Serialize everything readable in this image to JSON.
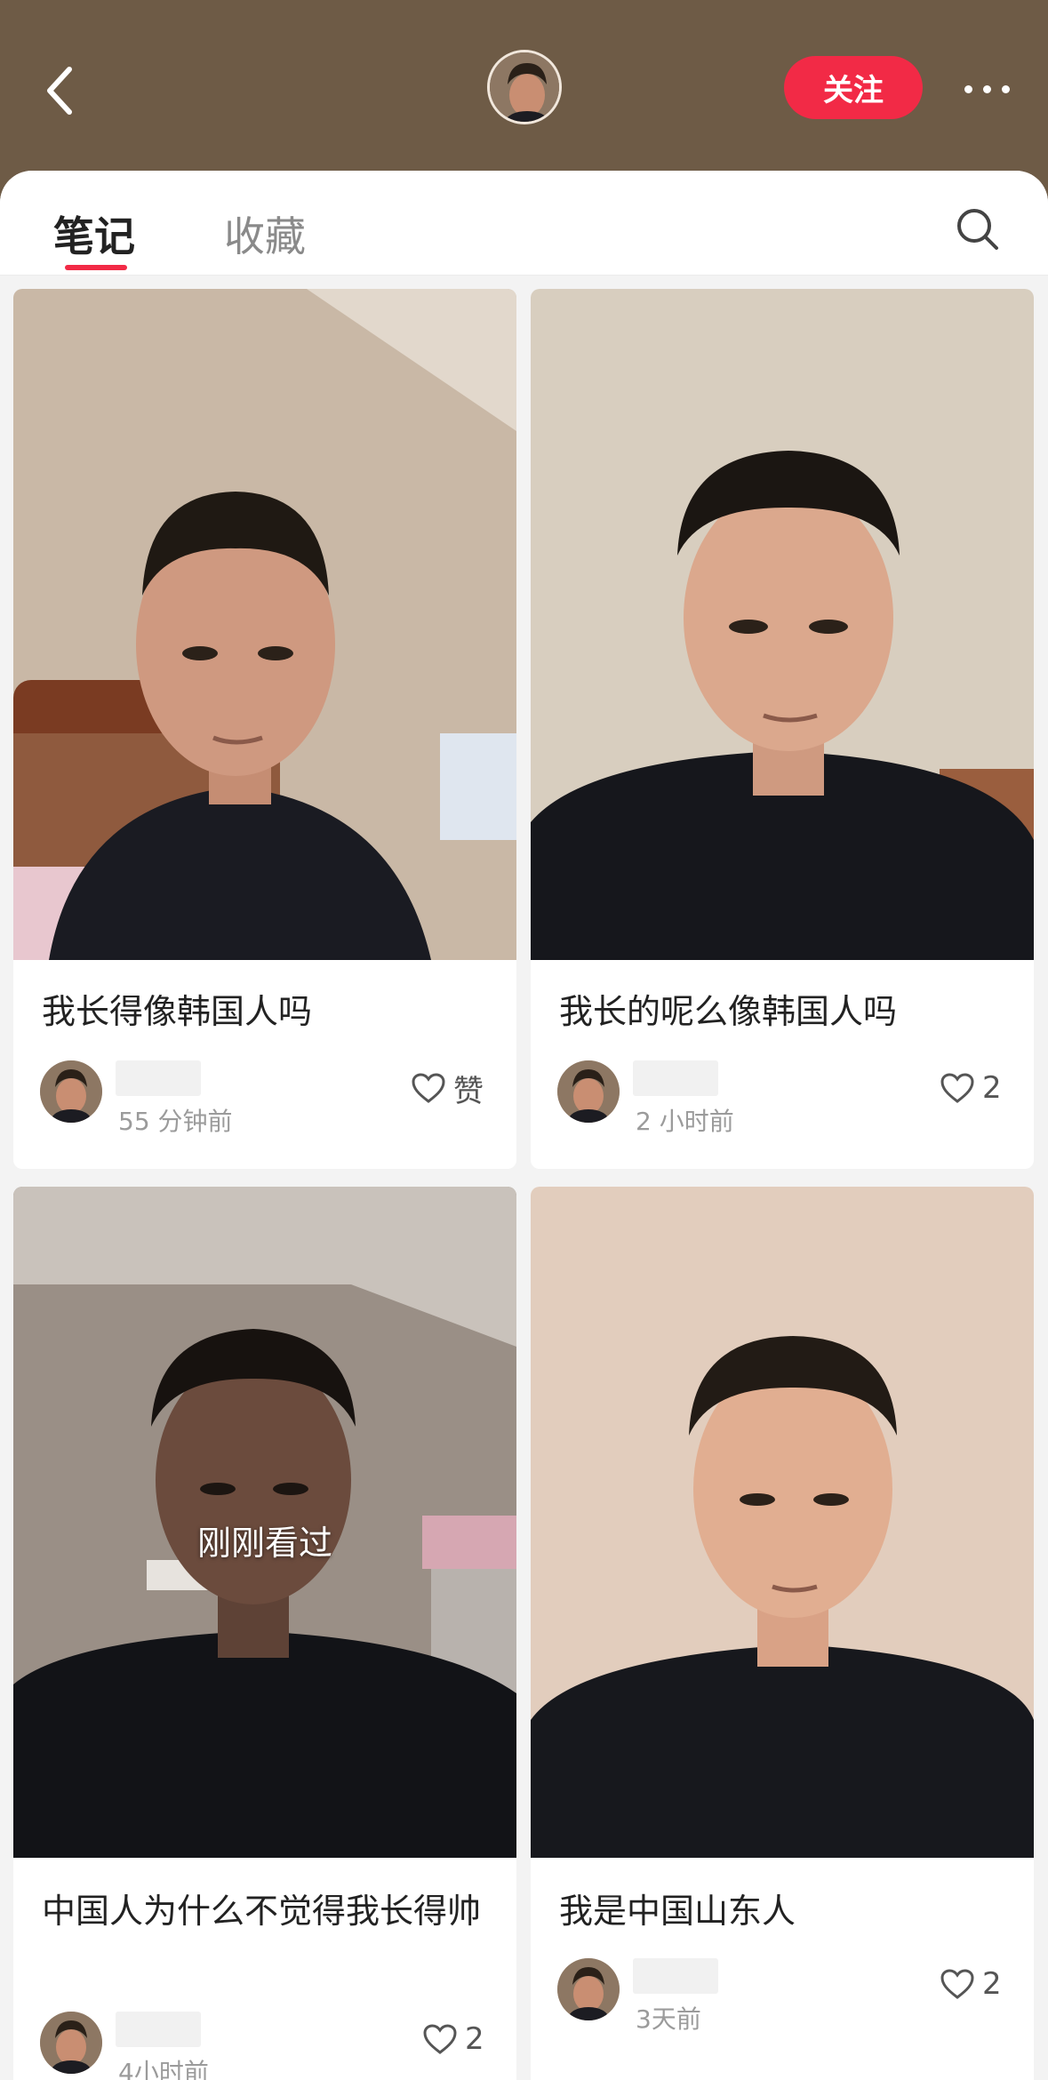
{
  "header": {
    "follow_label": "关注"
  },
  "tabs": {
    "notes": "笔记",
    "collect": "收藏"
  },
  "cards": [
    {
      "title": "我长得像韩国人吗",
      "time": "55 分钟前",
      "likes": "赞",
      "watched": ""
    },
    {
      "title": "我长的呢么像韩国人吗",
      "time": "2 小时前",
      "likes": "2",
      "watched": ""
    },
    {
      "title": "中国人为什么不觉得我长得帅",
      "time": "4小时前",
      "likes": "2",
      "watched": "刚刚看过"
    },
    {
      "title": "我是中国山东人",
      "time": "3天前",
      "likes": "2",
      "watched": ""
    }
  ],
  "icons": {
    "back": "chevron-left-icon",
    "more": "more-dots-icon",
    "search": "search-icon",
    "like": "heart-outline-icon"
  },
  "colors": {
    "header_bg": "#6e5b46",
    "accent": "#f22a46",
    "panel_bg": "#f3f3f3"
  }
}
